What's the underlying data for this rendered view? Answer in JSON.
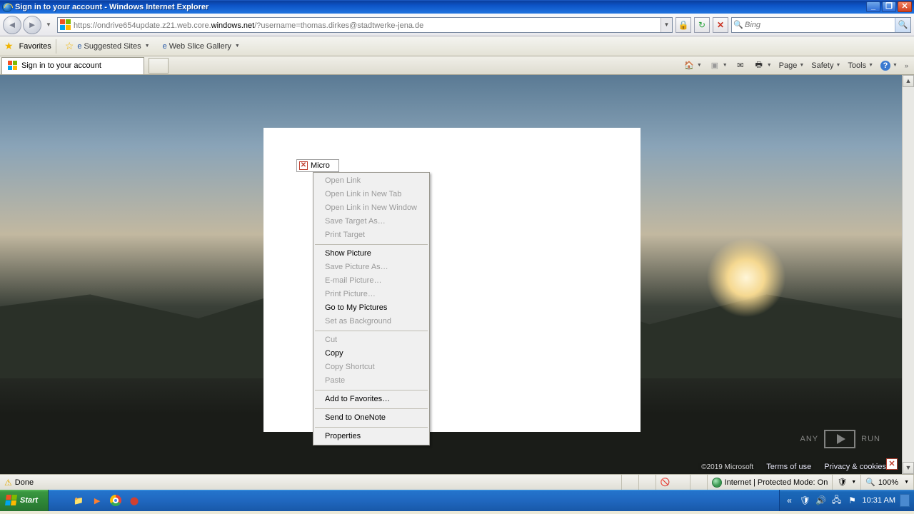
{
  "window": {
    "title": "Sign in to your account - Windows Internet Explorer"
  },
  "nav": {
    "url_grey1": "https://",
    "url_grey2": "ondrive654update.z21.web.core.",
    "url_dark": "windows.net",
    "url_grey3": "/?username=thomas.dirkes@stadtwerke-jena.de",
    "search_placeholder": "Bing"
  },
  "favbar": {
    "favorites": "Favorites",
    "suggested": "Suggested Sites",
    "webslice": "Web Slice Gallery"
  },
  "tab": {
    "title": "Sign in to your account"
  },
  "cmdbar": {
    "page": "Page",
    "safety": "Safety",
    "tools": "Tools"
  },
  "broken_alt": "Micro",
  "context_menu": {
    "open_link": "Open Link",
    "open_link_tab": "Open Link in New Tab",
    "open_link_win": "Open Link in New Window",
    "save_target": "Save Target As…",
    "print_target": "Print Target",
    "show_picture": "Show Picture",
    "save_picture": "Save Picture As…",
    "email_picture": "E-mail Picture…",
    "print_picture": "Print Picture…",
    "goto_pictures": "Go to My Pictures",
    "set_background": "Set as Background",
    "cut": "Cut",
    "copy": "Copy",
    "copy_shortcut": "Copy Shortcut",
    "paste": "Paste",
    "add_favorites": "Add to Favorites…",
    "send_onenote": "Send to OneNote",
    "properties": "Properties"
  },
  "footer": {
    "copyright": "©2019 Microsoft",
    "terms": "Terms of use",
    "privacy": "Privacy & cookies"
  },
  "watermark": {
    "a": "ANY",
    "b": "RUN"
  },
  "status": {
    "done": "Done",
    "zone": "Internet | Protected Mode: On",
    "zoom": "100%"
  },
  "taskbar": {
    "start": "Start",
    "clock": "10:31 AM"
  }
}
